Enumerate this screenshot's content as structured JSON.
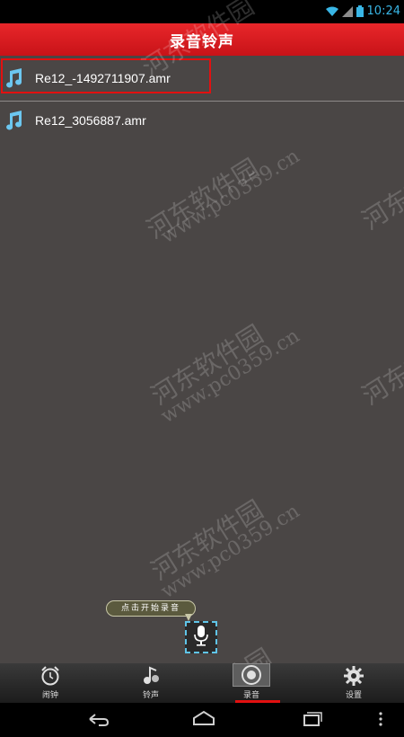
{
  "status_bar": {
    "time": "10:24"
  },
  "header": {
    "title": "录音铃声"
  },
  "files": [
    {
      "name": "Re12_-1492711907.amr",
      "highlighted": true
    },
    {
      "name": "Re12_3056887.amr",
      "highlighted": false
    }
  ],
  "recorder": {
    "tooltip": "点击开始录音",
    "mic_icon": "microphone-icon"
  },
  "tabs": [
    {
      "label": "闹钟",
      "icon": "alarm-clock-icon"
    },
    {
      "label": "铃声",
      "icon": "music-notes-icon"
    },
    {
      "label": "录音",
      "icon": "record-icon",
      "active": true
    },
    {
      "label": "设置",
      "icon": "gear-icon"
    }
  ],
  "watermark": {
    "text_cn": "河东软件园",
    "text_url": "www.pc0359.cn"
  },
  "colors": {
    "title_bar": "#d61a1f",
    "accent": "#39b6e6",
    "background": "#4a4645",
    "highlight_border": "#e21010"
  }
}
